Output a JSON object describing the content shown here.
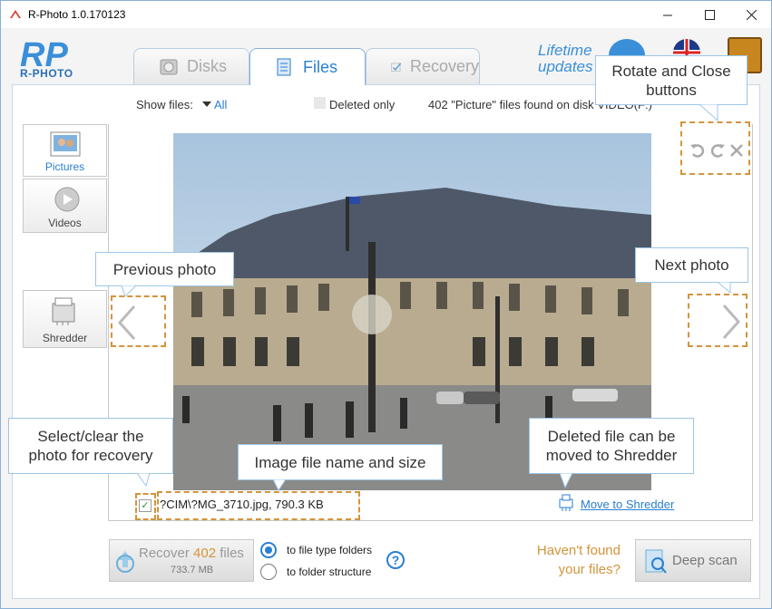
{
  "window": {
    "title": "R-Photo 1.0.170123",
    "minimize_icon": "minimize-icon",
    "maximize_icon": "maximize-icon",
    "close_icon": "close-icon"
  },
  "header": {
    "logo_text": "R-PHOTO",
    "tabs": [
      {
        "label": "Disks",
        "icon": "disk-icon",
        "active": false
      },
      {
        "label": "Files",
        "icon": "files-icon",
        "active": true
      },
      {
        "label": "Recovery",
        "icon": "recovery-icon",
        "active": false
      }
    ],
    "lifetime_line1": "Lifetime",
    "lifetime_line2": "updates"
  },
  "filter": {
    "show_files_label": "Show files:",
    "show_files_value": "All",
    "deleted_only_label": "Deleted only",
    "found_text": "402 \"Picture\" files found on disk VIDEO(F:)"
  },
  "categories": [
    {
      "label": "Pictures",
      "icon": "pictures-icon",
      "active": true
    },
    {
      "label": "Videos",
      "icon": "videos-icon",
      "active": false
    },
    {
      "label": "Shredder",
      "icon": "shredder-icon",
      "active": false
    }
  ],
  "viewer": {
    "file_name": "?CIM\\?MG_3710.jpg, 790.3 KB",
    "move_to_shredder": "Move to Shredder",
    "selected": true
  },
  "callouts": {
    "rotate_close": "Rotate and Close buttons",
    "previous": "Previous photo",
    "next": "Next photo",
    "select": "Select/clear the photo for recovery",
    "name_size": "Image file name and size",
    "shredder": "Deleted file can be moved to Shredder"
  },
  "bottom": {
    "recover_prefix": "Recover",
    "recover_count": "402",
    "recover_suffix": "files",
    "recover_size": "733.7 MB",
    "radio_type": "to file type folders",
    "radio_structure": "to folder structure",
    "havent_line1": "Haven't found",
    "havent_line2": "your files?",
    "deep_scan": "Deep scan"
  },
  "colors": {
    "accent": "#2a7fd0",
    "orange": "#d4943c",
    "callout_border": "#9cc6e8"
  }
}
